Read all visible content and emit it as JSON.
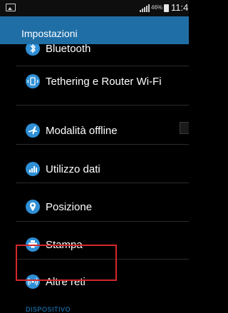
{
  "status_bar": {
    "battery_percent": "46%",
    "time": "11:4"
  },
  "action_bar": {
    "title": "Impostazioni"
  },
  "settings": [
    {
      "id": "bluetooth",
      "label": "Bluetooth",
      "icon": "bluetooth-icon"
    },
    {
      "id": "tethering",
      "label": "Tethering e Router Wi-Fi",
      "icon": "tethering-icon"
    },
    {
      "id": "offline",
      "label": "Modalità offline",
      "icon": "airplane-icon",
      "toggle": "off"
    },
    {
      "id": "data-usage",
      "label": "Utilizzo dati",
      "icon": "data-usage-icon"
    },
    {
      "id": "location",
      "label": "Posizione",
      "icon": "location-pin-icon"
    },
    {
      "id": "print",
      "label": "Stampa",
      "icon": "printer-icon"
    },
    {
      "id": "more-networks",
      "label": "Altre reti",
      "icon": "more-networks-icon"
    }
  ],
  "section_header": "DISPOSITIVO",
  "colors": {
    "action_bar": "#1f6ea6",
    "icon_blue": "#2f8fd6",
    "highlight_red": "#d5282b",
    "section_header": "#1f8ad1"
  }
}
